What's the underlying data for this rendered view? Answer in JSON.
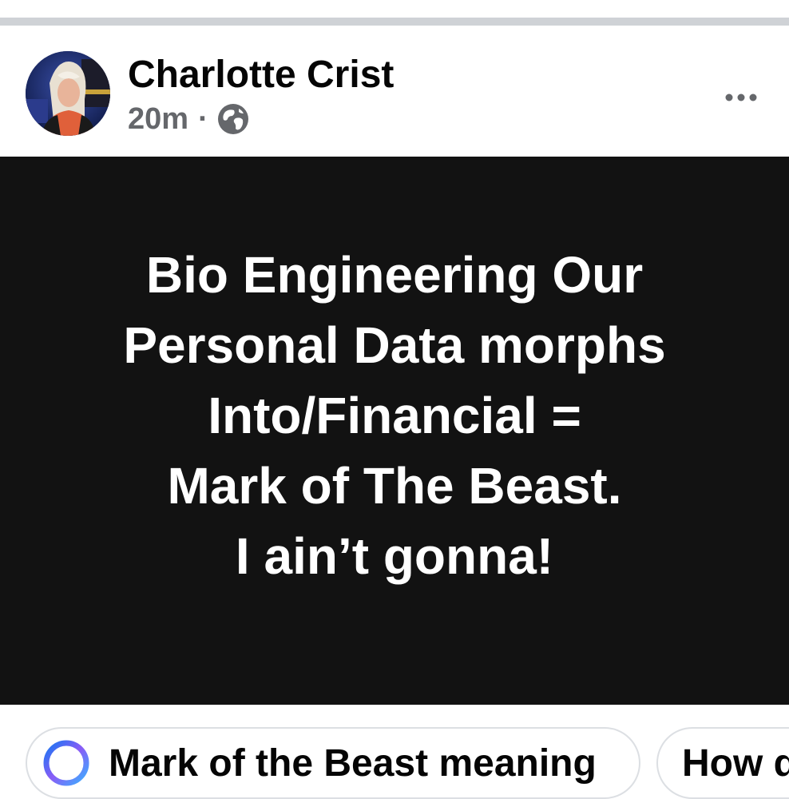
{
  "post": {
    "author": "Charlotte Crist",
    "time": "20m",
    "separator": "·",
    "audience_icon": "globe-icon",
    "more_icon": "more-horizontal-icon",
    "image_text_lines": [
      "Bio Engineering Our",
      "Personal Data morphs",
      "Into/Financial =",
      "Mark of The Beast.",
      "I ain’t gonna!"
    ]
  },
  "suggestions": {
    "chips": [
      {
        "label": "Mark of the Beast meaning",
        "icon": "ai-search-ring-icon"
      },
      {
        "label": "How d"
      }
    ]
  },
  "colors": {
    "divider": "#cfd2d6",
    "image_background": "#121212",
    "secondary_text": "#65676b",
    "ring_gradient": [
      "#1877f2",
      "#8a5cf6",
      "#3ab0ff"
    ]
  }
}
